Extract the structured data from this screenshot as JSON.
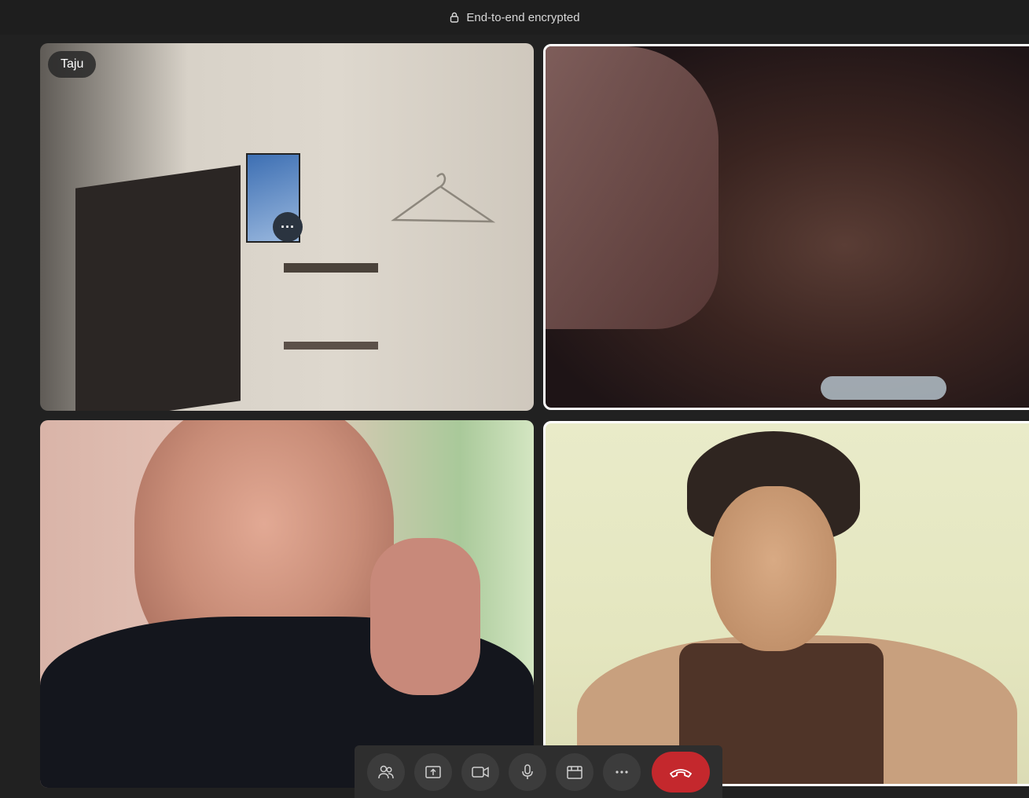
{
  "topbar": {
    "encryption_label": "End-to-end encrypted",
    "icon": "lock-icon"
  },
  "tiles": [
    {
      "participant_name": "Taju",
      "active_speaker": false,
      "has_more_button": true
    },
    {
      "participant_name": "",
      "active_speaker": true
    },
    {
      "participant_name": "",
      "active_speaker": false
    },
    {
      "participant_name": "",
      "active_speaker": true
    }
  ],
  "more_button": {
    "label": "···"
  },
  "callbar": {
    "buttons": [
      {
        "icon": "participants-icon"
      },
      {
        "icon": "share-screen-icon"
      },
      {
        "icon": "video-camera-icon"
      },
      {
        "icon": "microphone-icon"
      },
      {
        "icon": "view-layout-icon"
      },
      {
        "icon": "more-options-icon"
      },
      {
        "icon": "end-call-icon"
      }
    ],
    "end_call_color": "#c4282d"
  },
  "colors": {
    "background": "#202020",
    "active_border": "#ffffff"
  }
}
